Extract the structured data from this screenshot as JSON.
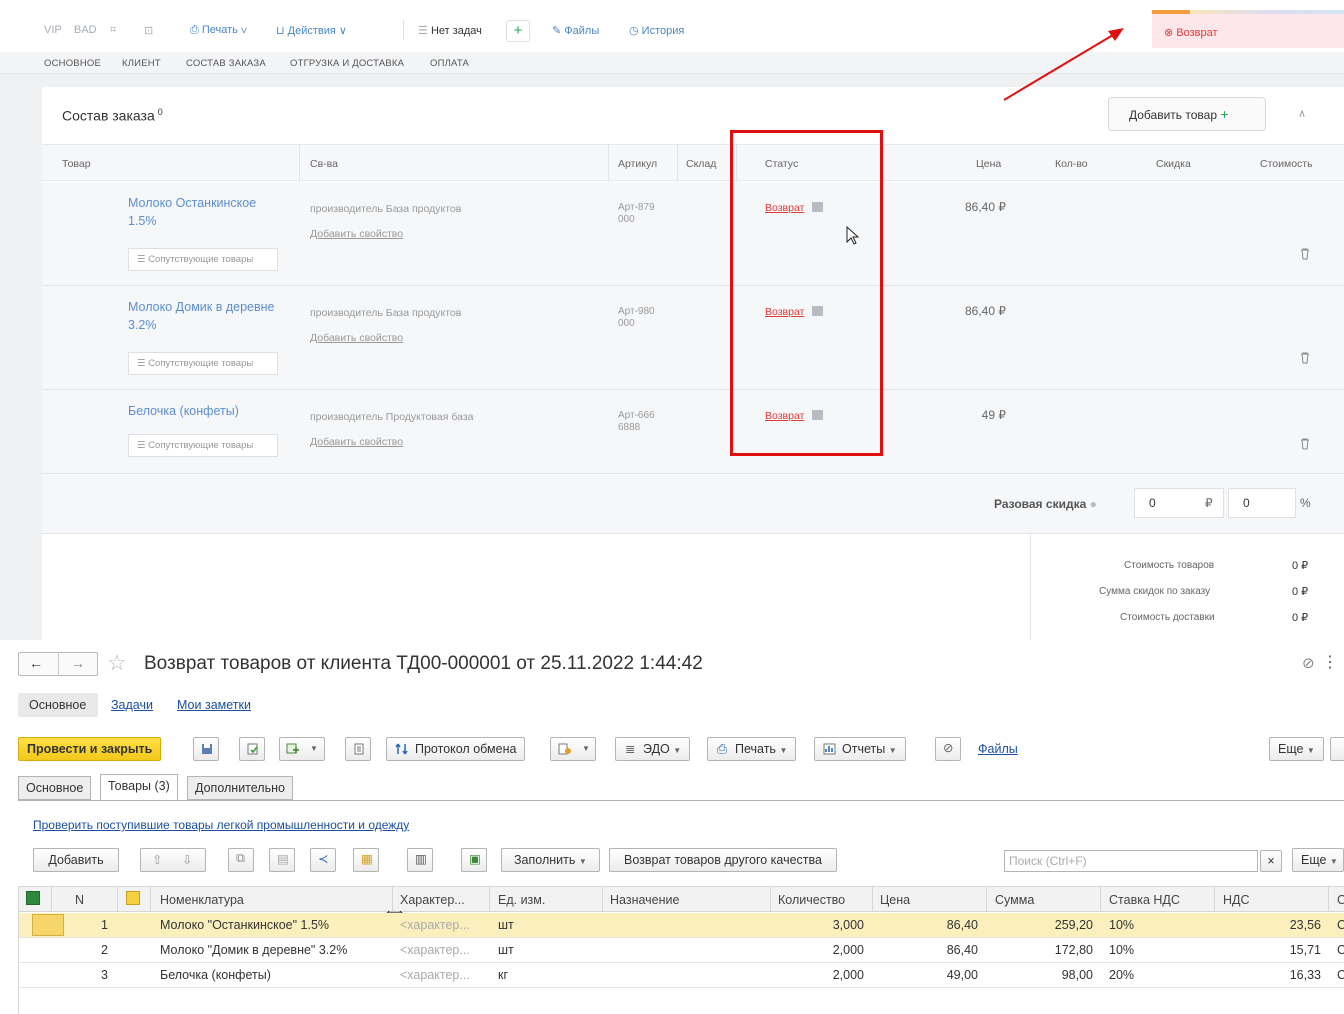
{
  "crm": {
    "toolbar": {
      "vip": "VIP",
      "bad": "BAD",
      "print": "Печать",
      "actions": "Действия",
      "no_tasks": "Нет задач",
      "files": "Файлы",
      "history": "История"
    },
    "status_badge": "Возврат",
    "tabs": [
      "ОСНОВНОЕ",
      "КЛИЕНТ",
      "СОСТАВ ЗАКАЗА",
      "ОТГРУЗКА И ДОСТАВКА",
      "ОПЛАТА"
    ],
    "section_title": "Состав заказа",
    "section_count": "0",
    "add_item_button": "Добавить товар",
    "columns": [
      "Товар",
      "Св-ва",
      "Артикул",
      "Склад",
      "Статус",
      "Цена",
      "Кол-во",
      "Скидка",
      "Стоимость"
    ],
    "rows": [
      {
        "name": "Молоко Останкинское 1.5%",
        "prop": "производитель База продуктов",
        "add_prop": "Добавить свойство",
        "article": "Арт-879 000",
        "status": "Возврат",
        "price": "86,40 ₽",
        "related": "Сопутствующие товары"
      },
      {
        "name": "Молоко Домик в деревне 3.2%",
        "prop": "производитель База продуктов",
        "add_prop": "Добавить свойство",
        "article": "Арт-980 000",
        "status": "Возврат",
        "price": "86,40 ₽",
        "related": "Сопутствующие товары"
      },
      {
        "name": "Белочка (конфеты)",
        "prop": "производитель Продуктовая база",
        "add_prop": "Добавить свойство",
        "article": "Арт-666 6888",
        "status": "Возврат",
        "price": "49 ₽",
        "related": "Сопутствующие товары"
      }
    ],
    "one_time_discount": {
      "label": "Разовая скидка",
      "rub_value": "0",
      "rub_unit": "₽",
      "pct_value": "0",
      "pct_unit": "%"
    },
    "summary": [
      {
        "label": "Стоимость товаров",
        "value": "0 ₽"
      },
      {
        "label": "Сумма скидок по заказу",
        "value": "0 ₽"
      },
      {
        "label": "Стоимость доставки",
        "value": "0 ₽"
      }
    ]
  },
  "doc": {
    "title": "Возврат товаров от клиента ТД00-000001 от 25.11.2022 1:44:42",
    "nav_tabs": [
      "Основное",
      "Задачи",
      "Мои заметки"
    ],
    "toolbar": {
      "post_close": "Провести и закрыть",
      "exchange_protocol": "Протокол обмена",
      "edo": "ЭДО",
      "print": "Печать",
      "reports": "Отчеты",
      "files": "Файлы",
      "more": "Еще"
    },
    "tabs": [
      "Основное",
      "Товары (3)",
      "Дополнительно"
    ],
    "check_link": "Проверить поступившие товары легкой промышленности и одежду",
    "grid_toolbar": {
      "add": "Добавить",
      "fill": "Заполнить",
      "return_other_quality": "Возврат товаров другого качества",
      "search_placeholder": "Поиск (Ctrl+F)",
      "clear": "×",
      "more": "Еще"
    },
    "grid_columns": [
      "N",
      "Номенклатура",
      "Характер...",
      "Ед. изм.",
      "Назначение",
      "Количество",
      "Цена",
      "Сумма",
      "Ставка НДС",
      "НДС",
      "С"
    ],
    "grid_rows": [
      {
        "n": "1",
        "name": "Молоко \"Останкинское\" 1.5%",
        "char": "<характер...",
        "unit": "шт",
        "qty": "3,000",
        "price": "86,40",
        "sum": "259,20",
        "vat_rate": "10%",
        "vat": "23,56",
        "tail": "С"
      },
      {
        "n": "2",
        "name": "Молоко \"Домик в деревне\" 3.2%",
        "char": "<характер...",
        "unit": "шт",
        "qty": "2,000",
        "price": "86,40",
        "sum": "172,80",
        "vat_rate": "10%",
        "vat": "15,71",
        "tail": "С"
      },
      {
        "n": "3",
        "name": "Белочка (конфеты)",
        "char": "<характер...",
        "unit": "кг",
        "qty": "2,000",
        "price": "49,00",
        "sum": "98,00",
        "vat_rate": "20%",
        "vat": "16,33",
        "tail": "С"
      }
    ]
  }
}
